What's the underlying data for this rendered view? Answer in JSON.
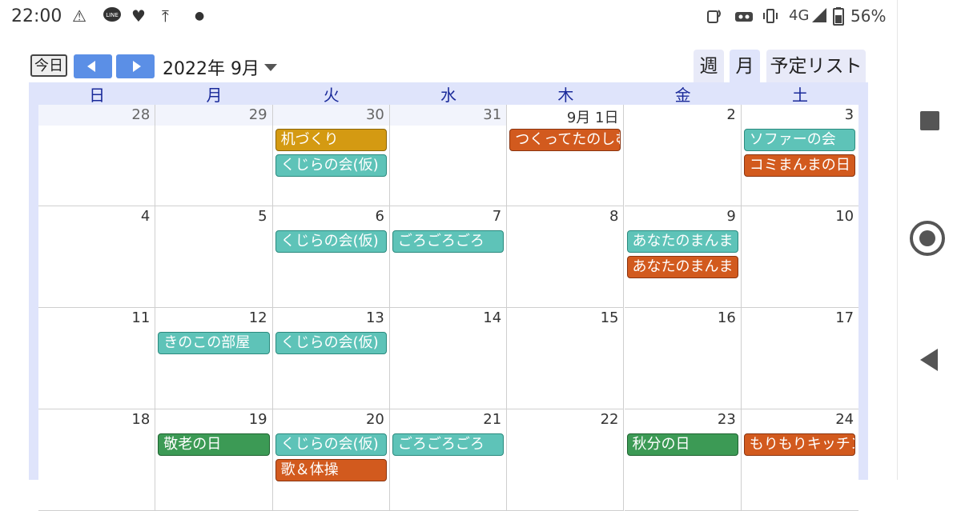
{
  "status_bar": {
    "time": "22:00",
    "network": "4G",
    "battery": "56%",
    "left_icons": [
      "warning-icon",
      "line-app-icon",
      "heart-icon",
      "upload-icon",
      "dot-icon"
    ],
    "right_icons": [
      "nfc-icon",
      "vr-icon",
      "vibrate-icon",
      "signal-icon",
      "battery-icon"
    ]
  },
  "toolbar": {
    "today_label": "今日",
    "month_label": "2022年 9月",
    "views": {
      "week": "週",
      "month": "月",
      "list": "予定リスト"
    }
  },
  "calendar": {
    "weekdays": [
      "日",
      "月",
      "火",
      "水",
      "木",
      "金",
      "土"
    ],
    "weeks": [
      [
        {
          "day": "28",
          "events": []
        },
        {
          "day": "29",
          "events": []
        },
        {
          "day": "30",
          "events": [
            {
              "title": "机づくり",
              "color": "gold"
            },
            {
              "title": "くじらの会(仮)",
              "color": "teal"
            }
          ]
        },
        {
          "day": "31",
          "events": []
        },
        {
          "day": "9月 1日",
          "events": [
            {
              "title": "つくってたのしむ",
              "color": "orange"
            }
          ]
        },
        {
          "day": "2",
          "events": []
        },
        {
          "day": "3",
          "events": [
            {
              "title": "ソファーの会",
              "color": "teal"
            },
            {
              "title": "コミまんまの日",
              "color": "orange"
            }
          ]
        }
      ],
      [
        {
          "day": "4",
          "events": []
        },
        {
          "day": "5",
          "events": []
        },
        {
          "day": "6",
          "events": [
            {
              "title": "くじらの会(仮)",
              "color": "teal"
            }
          ]
        },
        {
          "day": "7",
          "events": [
            {
              "title": "ごろごろごろ",
              "color": "teal"
            }
          ]
        },
        {
          "day": "8",
          "events": []
        },
        {
          "day": "9",
          "events": [
            {
              "title": "あなたのまんま",
              "color": "teal"
            },
            {
              "title": "あなたのまんま",
              "color": "orange"
            }
          ]
        },
        {
          "day": "10",
          "events": []
        }
      ],
      [
        {
          "day": "11",
          "events": []
        },
        {
          "day": "12",
          "events": [
            {
              "title": "きのこの部屋",
              "color": "teal"
            }
          ]
        },
        {
          "day": "13",
          "events": [
            {
              "title": "くじらの会(仮)",
              "color": "teal"
            }
          ]
        },
        {
          "day": "14",
          "events": []
        },
        {
          "day": "15",
          "events": []
        },
        {
          "day": "16",
          "events": []
        },
        {
          "day": "17",
          "events": []
        }
      ],
      [
        {
          "day": "18",
          "events": []
        },
        {
          "day": "19",
          "events": [
            {
              "title": "敬老の日",
              "color": "green"
            }
          ]
        },
        {
          "day": "20",
          "events": [
            {
              "title": "くじらの会(仮)",
              "color": "teal"
            },
            {
              "title": "歌＆体操",
              "color": "orange"
            }
          ]
        },
        {
          "day": "21",
          "events": [
            {
              "title": "ごろごろごろ",
              "color": "teal"
            }
          ]
        },
        {
          "day": "22",
          "events": []
        },
        {
          "day": "23",
          "events": [
            {
              "title": "秋分の日",
              "color": "green"
            }
          ]
        },
        {
          "day": "24",
          "events": [
            {
              "title": "もりもりキッチン",
              "color": "orange"
            }
          ]
        }
      ]
    ]
  },
  "colors": {
    "header_band": "#dfe4fb",
    "weekday_text": "#1a2a9a",
    "nav_button": "#5b8fe6",
    "teal": "#5ec3b8",
    "orange": "#d25a1e",
    "gold": "#d49a12",
    "green": "#3c9a55"
  }
}
